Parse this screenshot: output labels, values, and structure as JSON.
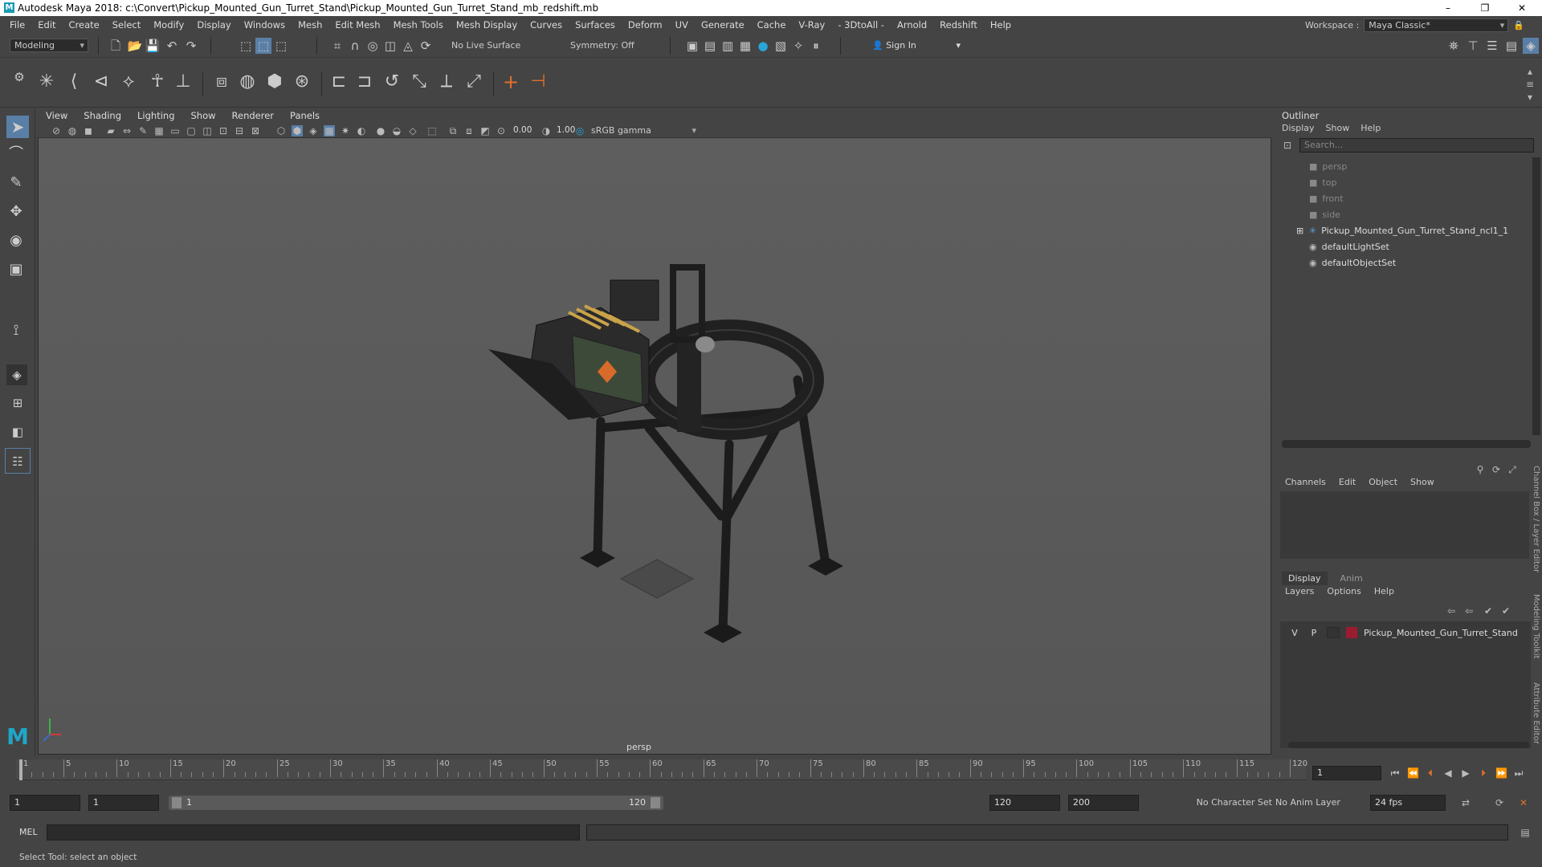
{
  "window": {
    "title": "Autodesk Maya 2018: c:\\Convert\\Pickup_Mounted_Gun_Turret_Stand\\Pickup_Mounted_Gun_Turret_Stand_mb_redshift.mb",
    "logo": "M",
    "minimize": "–",
    "maximize": "❐",
    "close": "✕"
  },
  "menu": [
    "File",
    "Edit",
    "Create",
    "Select",
    "Modify",
    "Display",
    "Windows",
    "Mesh",
    "Edit Mesh",
    "Mesh Tools",
    "Mesh Display",
    "Curves",
    "Surfaces",
    "Deform",
    "UV",
    "Generate",
    "Cache",
    "V-Ray",
    "- 3DtoAll -",
    "Arnold",
    "Redshift",
    "Help"
  ],
  "workspace": {
    "label": "Workspace :",
    "value": "Maya Classic*"
  },
  "statusline": {
    "mode": "Modeling",
    "live_surface": "No Live Surface",
    "symmetry": "Symmetry: Off",
    "sign_in": "Sign In"
  },
  "viewport": {
    "menus": [
      "View",
      "Shading",
      "Lighting",
      "Show",
      "Renderer",
      "Panels"
    ],
    "exposure": "0.00",
    "gamma": "1.00",
    "color_space": "sRGB gamma",
    "camera_label": "persp"
  },
  "outliner": {
    "title": "Outliner",
    "menus": [
      "Display",
      "Show",
      "Help"
    ],
    "search_placeholder": "Search...",
    "items": [
      {
        "label": "persp",
        "icon": "camera-icon",
        "dim": true
      },
      {
        "label": "top",
        "icon": "camera-icon",
        "dim": true
      },
      {
        "label": "front",
        "icon": "camera-icon",
        "dim": true
      },
      {
        "label": "side",
        "icon": "camera-icon",
        "dim": true
      },
      {
        "label": "Pickup_Mounted_Gun_Turret_Stand_ncl1_1",
        "icon": "group-icon",
        "dim": false,
        "expandable": true
      },
      {
        "label": "defaultLightSet",
        "icon": "set-icon",
        "dim": false
      },
      {
        "label": "defaultObjectSet",
        "icon": "set-icon",
        "dim": false
      }
    ]
  },
  "channelbox": {
    "menus": [
      "Channels",
      "Edit",
      "Object",
      "Show"
    ]
  },
  "layers": {
    "tabs": [
      "Display",
      "Anim"
    ],
    "menus": [
      "Layers",
      "Options",
      "Help"
    ],
    "row": {
      "v": "V",
      "p": "P",
      "name": "Pickup_Mounted_Gun_Turret_Stand",
      "color": "#9b1b30"
    }
  },
  "side_tabs": [
    "Channel Box / Layer Editor",
    "Modeling Toolkit",
    "Attribute Editor"
  ],
  "timeline": {
    "ticks": [
      "1",
      "5",
      "10",
      "15",
      "20",
      "25",
      "30",
      "35",
      "40",
      "45",
      "50",
      "55",
      "60",
      "65",
      "70",
      "75",
      "80",
      "85",
      "90",
      "95",
      "100",
      "105",
      "110",
      "115",
      "120"
    ],
    "current_frame": "1"
  },
  "range": {
    "start": "1",
    "anim_start": "1",
    "slider_start": "1",
    "slider_end": "120",
    "end": "120",
    "anim_end": "200",
    "character_set": "No Character Set",
    "anim_layer": "No Anim Layer",
    "fps": "24 fps"
  },
  "cmdline": {
    "label": "MEL"
  },
  "helpline": "Select Tool: select an object"
}
